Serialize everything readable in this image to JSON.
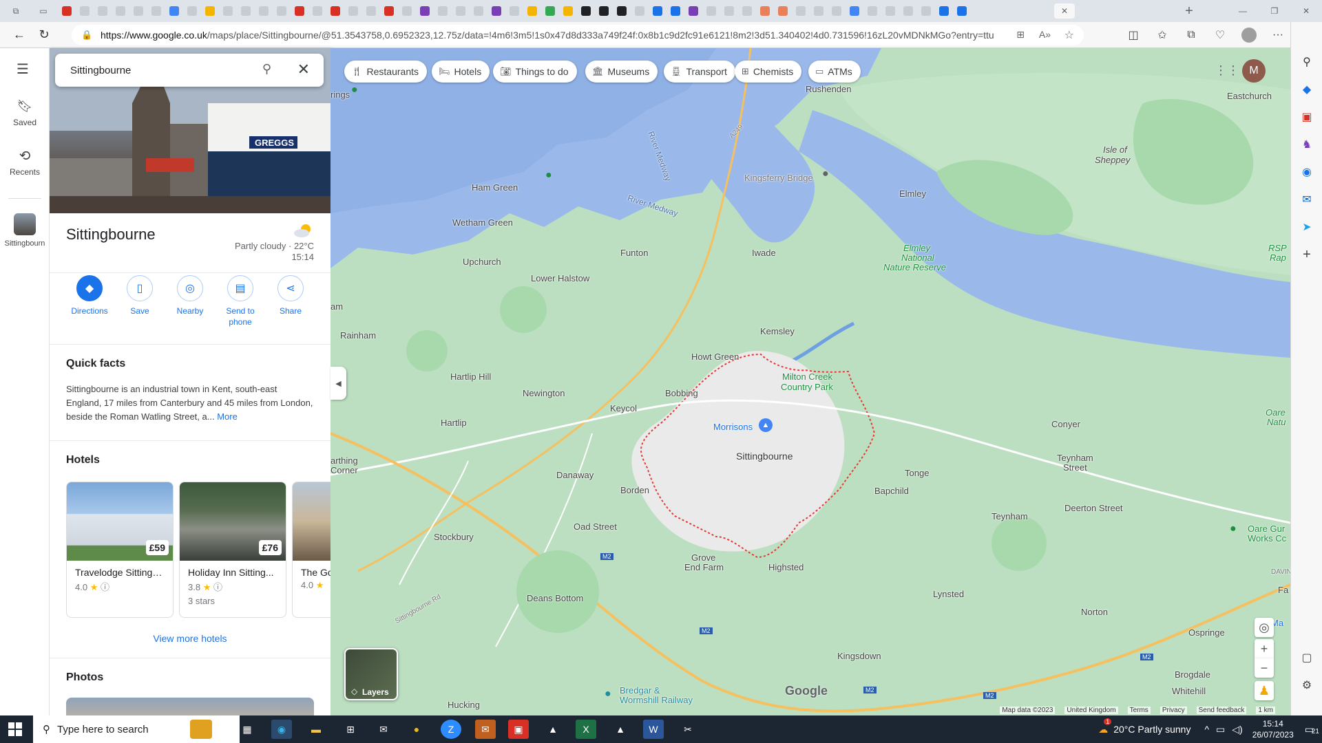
{
  "browser": {
    "url_host": "https://www.google.co.uk",
    "url_path": "/maps/place/Sittingbourne/@51.3543758,0.6952323,12.75z/data=!4m6!3m5!1s0x47d8d333a749f24f:0x8b1c9d2fc91e6121!8m2!3d51.340402!4d0.731596!16zL20vMDNkMGo?entry=ttu"
  },
  "rail": {
    "menu_icon": "hamburger-icon",
    "saved_label": "Saved",
    "recents_label": "Recents",
    "recent_place_label": "Sittingbourn"
  },
  "search": {
    "value": "Sittingbourne"
  },
  "place": {
    "name": "Sittingbourne",
    "weather_condition": "Partly cloudy · 22°C",
    "weather_time": "15:14",
    "shop_sign": "GREGGS"
  },
  "actions": [
    {
      "label": "Directions",
      "icon": "directions-icon"
    },
    {
      "label": "Save",
      "icon": "bookmark-icon"
    },
    {
      "label": "Nearby",
      "icon": "nearby-icon"
    },
    {
      "label": "Send to",
      "label2": "phone",
      "icon": "send-to-phone-icon"
    },
    {
      "label": "Share",
      "icon": "share-icon"
    }
  ],
  "quick_facts": {
    "heading": "Quick facts",
    "text": "Sittingbourne is an industrial town in Kent, south-east England, 17 miles from Canterbury and 45 miles from London, beside the Roman Watling Street, a...",
    "more_link": "More"
  },
  "hotels": {
    "heading": "Hotels",
    "items": [
      {
        "name": "Travelodge Sittingb...",
        "price": "£59",
        "rating": "4.0",
        "stars": ""
      },
      {
        "name": "Holiday Inn Sitting...",
        "price": "£76",
        "rating": "3.8",
        "stars": "3 stars"
      },
      {
        "name": "The Go",
        "price": "",
        "rating": "4.0",
        "stars": ""
      }
    ],
    "view_more": "View more hotels"
  },
  "photos": {
    "heading": "Photos"
  },
  "chips": [
    {
      "label": "Restaurants",
      "icon": "fork-knife-icon"
    },
    {
      "label": "Hotels",
      "icon": "bed-icon"
    },
    {
      "label": "Things to do",
      "icon": "camera-icon"
    },
    {
      "label": "Museums",
      "icon": "museum-icon"
    },
    {
      "label": "Transport",
      "icon": "train-icon"
    },
    {
      "label": "Chemists",
      "icon": "pharmacy-icon"
    },
    {
      "label": "ATMs",
      "icon": "atm-icon"
    }
  ],
  "map": {
    "places": {
      "rushenden": "Rushenden",
      "eastchurch": "Eastchurch",
      "isle_of_sheppey_1": "Isle of",
      "isle_of_sheppey_2": "Sheppey",
      "kingsferry_bridge": "Kingsferry Bridge",
      "ham_green": "Ham Green",
      "wetham_green": "Wetham Green",
      "upchurch": "Upchurch",
      "lower_halstow": "Lower Halstow",
      "funton": "Funton",
      "iwade": "Iwade",
      "elmley": "Elmley",
      "elmley_reserve_1": "Elmley",
      "elmley_reserve_2": "National",
      "elmley_reserve_3": "Nature Reserve",
      "rainham": "Rainham",
      "kemsley": "Kemsley",
      "howt_green": "Howt Green",
      "milton_creek_1": "Milton Creek",
      "milton_creek_2": "Country Park",
      "hartlip_hill": "Hartlip Hill",
      "newington": "Newington",
      "bobbing": "Bobbing",
      "keycol": "Keycol",
      "hartlip": "Hartlip",
      "morrisons": "Morrisons",
      "sittingbourne": "Sittingbourne",
      "conyer": "Conyer",
      "teynham_street_1": "Teynham",
      "teynham_street_2": "Street",
      "danaway": "Danaway",
      "borden": "Borden",
      "tonge": "Tonge",
      "bapchild": "Bapchild",
      "teynham": "Teynham",
      "deerton_street": "Deerton Street",
      "stockbury": "Stockbury",
      "oad_street": "Oad Street",
      "grove_end_farm_1": "Grove",
      "grove_end_farm_2": "End Farm",
      "highsted": "Highsted",
      "deans_bottom": "Deans Bottom",
      "lynsted": "Lynsted",
      "norton": "Norton",
      "ospringe": "Ospringe",
      "kingsdown": "Kingsdown",
      "brogdale": "Brogdale",
      "whitehill": "Whitehill",
      "hucking": "Hucking",
      "bredgar_1": "Bredgar &",
      "bredgar_2": "Wormshill Railway",
      "thing_corner_1": "arthing",
      "thing_corner_2": "Corner",
      "oare_works_1": "Oare Gur",
      "oare_works_2": "Works Cc",
      "oare_1": "Oare",
      "oare_2": "Natu",
      "rsp_1": "RSP",
      "rsp_2": "Rap",
      "davin": "DAVIN",
      "fa": "Fa",
      "ma": "Ma",
      "am": "am",
      "rings": "rings",
      "river_medway_1": "River Medway",
      "river_medway_2": "River Medway",
      "a249": "A249",
      "sittingbourne_rd": "Sittingbourne Rd",
      "m2_1": "M2",
      "m2_2": "M2",
      "m2_3": "M2",
      "m2_4": "M2",
      "m2_5": "M2"
    },
    "layers_label": "Layers",
    "google_logo": "Google",
    "footer": {
      "map_data": "Map data ©2023",
      "country": "United Kingdom",
      "terms": "Terms",
      "privacy": "Privacy",
      "feedback": "Send feedback",
      "scale": "1 km"
    },
    "account_initial": "M"
  },
  "taskbar": {
    "search_placeholder": "Type here to search",
    "weather": "20°C  Partly sunny",
    "weather_badge": "1",
    "time": "15:14",
    "date": "26/07/2023",
    "notifications": "21"
  }
}
